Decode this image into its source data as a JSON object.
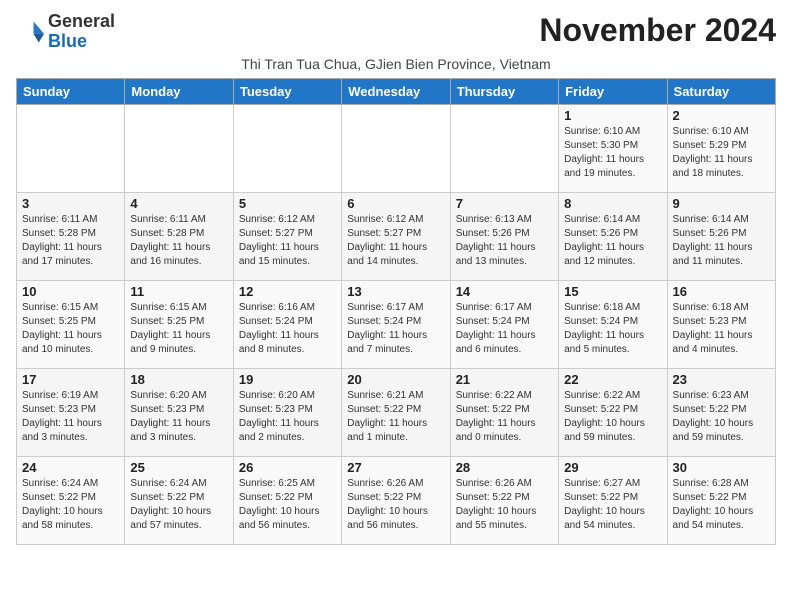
{
  "logo": {
    "general": "General",
    "blue": "Blue"
  },
  "title": "November 2024",
  "subtitle": "Thi Tran Tua Chua, GJien Bien Province, Vietnam",
  "days_header": [
    "Sunday",
    "Monday",
    "Tuesday",
    "Wednesday",
    "Thursday",
    "Friday",
    "Saturday"
  ],
  "weeks": [
    [
      {
        "day": "",
        "info": ""
      },
      {
        "day": "",
        "info": ""
      },
      {
        "day": "",
        "info": ""
      },
      {
        "day": "",
        "info": ""
      },
      {
        "day": "",
        "info": ""
      },
      {
        "day": "1",
        "info": "Sunrise: 6:10 AM\nSunset: 5:30 PM\nDaylight: 11 hours and 19 minutes."
      },
      {
        "day": "2",
        "info": "Sunrise: 6:10 AM\nSunset: 5:29 PM\nDaylight: 11 hours and 18 minutes."
      }
    ],
    [
      {
        "day": "3",
        "info": "Sunrise: 6:11 AM\nSunset: 5:28 PM\nDaylight: 11 hours and 17 minutes."
      },
      {
        "day": "4",
        "info": "Sunrise: 6:11 AM\nSunset: 5:28 PM\nDaylight: 11 hours and 16 minutes."
      },
      {
        "day": "5",
        "info": "Sunrise: 6:12 AM\nSunset: 5:27 PM\nDaylight: 11 hours and 15 minutes."
      },
      {
        "day": "6",
        "info": "Sunrise: 6:12 AM\nSunset: 5:27 PM\nDaylight: 11 hours and 14 minutes."
      },
      {
        "day": "7",
        "info": "Sunrise: 6:13 AM\nSunset: 5:26 PM\nDaylight: 11 hours and 13 minutes."
      },
      {
        "day": "8",
        "info": "Sunrise: 6:14 AM\nSunset: 5:26 PM\nDaylight: 11 hours and 12 minutes."
      },
      {
        "day": "9",
        "info": "Sunrise: 6:14 AM\nSunset: 5:26 PM\nDaylight: 11 hours and 11 minutes."
      }
    ],
    [
      {
        "day": "10",
        "info": "Sunrise: 6:15 AM\nSunset: 5:25 PM\nDaylight: 11 hours and 10 minutes."
      },
      {
        "day": "11",
        "info": "Sunrise: 6:15 AM\nSunset: 5:25 PM\nDaylight: 11 hours and 9 minutes."
      },
      {
        "day": "12",
        "info": "Sunrise: 6:16 AM\nSunset: 5:24 PM\nDaylight: 11 hours and 8 minutes."
      },
      {
        "day": "13",
        "info": "Sunrise: 6:17 AM\nSunset: 5:24 PM\nDaylight: 11 hours and 7 minutes."
      },
      {
        "day": "14",
        "info": "Sunrise: 6:17 AM\nSunset: 5:24 PM\nDaylight: 11 hours and 6 minutes."
      },
      {
        "day": "15",
        "info": "Sunrise: 6:18 AM\nSunset: 5:24 PM\nDaylight: 11 hours and 5 minutes."
      },
      {
        "day": "16",
        "info": "Sunrise: 6:18 AM\nSunset: 5:23 PM\nDaylight: 11 hours and 4 minutes."
      }
    ],
    [
      {
        "day": "17",
        "info": "Sunrise: 6:19 AM\nSunset: 5:23 PM\nDaylight: 11 hours and 3 minutes."
      },
      {
        "day": "18",
        "info": "Sunrise: 6:20 AM\nSunset: 5:23 PM\nDaylight: 11 hours and 3 minutes."
      },
      {
        "day": "19",
        "info": "Sunrise: 6:20 AM\nSunset: 5:23 PM\nDaylight: 11 hours and 2 minutes."
      },
      {
        "day": "20",
        "info": "Sunrise: 6:21 AM\nSunset: 5:22 PM\nDaylight: 11 hours and 1 minute."
      },
      {
        "day": "21",
        "info": "Sunrise: 6:22 AM\nSunset: 5:22 PM\nDaylight: 11 hours and 0 minutes."
      },
      {
        "day": "22",
        "info": "Sunrise: 6:22 AM\nSunset: 5:22 PM\nDaylight: 10 hours and 59 minutes."
      },
      {
        "day": "23",
        "info": "Sunrise: 6:23 AM\nSunset: 5:22 PM\nDaylight: 10 hours and 59 minutes."
      }
    ],
    [
      {
        "day": "24",
        "info": "Sunrise: 6:24 AM\nSunset: 5:22 PM\nDaylight: 10 hours and 58 minutes."
      },
      {
        "day": "25",
        "info": "Sunrise: 6:24 AM\nSunset: 5:22 PM\nDaylight: 10 hours and 57 minutes."
      },
      {
        "day": "26",
        "info": "Sunrise: 6:25 AM\nSunset: 5:22 PM\nDaylight: 10 hours and 56 minutes."
      },
      {
        "day": "27",
        "info": "Sunrise: 6:26 AM\nSunset: 5:22 PM\nDaylight: 10 hours and 56 minutes."
      },
      {
        "day": "28",
        "info": "Sunrise: 6:26 AM\nSunset: 5:22 PM\nDaylight: 10 hours and 55 minutes."
      },
      {
        "day": "29",
        "info": "Sunrise: 6:27 AM\nSunset: 5:22 PM\nDaylight: 10 hours and 54 minutes."
      },
      {
        "day": "30",
        "info": "Sunrise: 6:28 AM\nSunset: 5:22 PM\nDaylight: 10 hours and 54 minutes."
      }
    ]
  ]
}
